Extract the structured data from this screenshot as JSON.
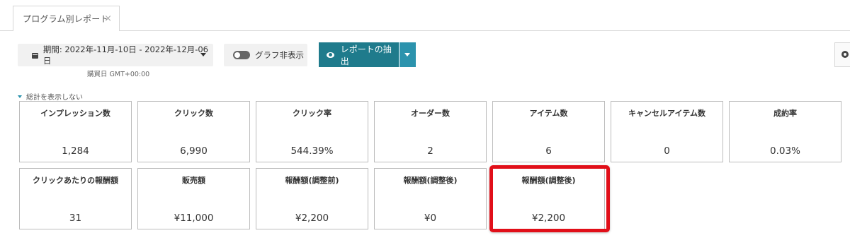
{
  "tabs": [
    {
      "label": "プログラム別レポート",
      "close": "×"
    }
  ],
  "toolbar": {
    "period_label": "期間: 2022年-11月-10日 - 2022年-12月-06日",
    "timezone_note": "購買日 GMT+00:00",
    "graph_toggle_label": "グラフ非表示",
    "extract_label": "レポートの抽出"
  },
  "summary_toggle_label": "総計を表示しない",
  "metrics": [
    {
      "title": "インプレッション数",
      "value": "1,284"
    },
    {
      "title": "クリック数",
      "value": "6,990"
    },
    {
      "title": "クリック率",
      "value": "544.39%"
    },
    {
      "title": "オーダー数",
      "value": "2"
    },
    {
      "title": "アイテム数",
      "value": "6"
    },
    {
      "title": "キャンセルアイテム数",
      "value": "0"
    },
    {
      "title": "成約率",
      "value": "0.03%"
    },
    {
      "title": "クリックあたりの報酬額",
      "value": "31"
    },
    {
      "title": "販売額",
      "value": "¥11,000"
    },
    {
      "title": "報酬額(調整前)",
      "value": "¥2,200"
    },
    {
      "title": "報酬額(調整後)",
      "value": "¥0"
    },
    {
      "title": "報酬額(調整後)",
      "value": "¥2,200"
    }
  ],
  "highlight_color": "#e10f19",
  "accent_color": "#1f7b8c"
}
